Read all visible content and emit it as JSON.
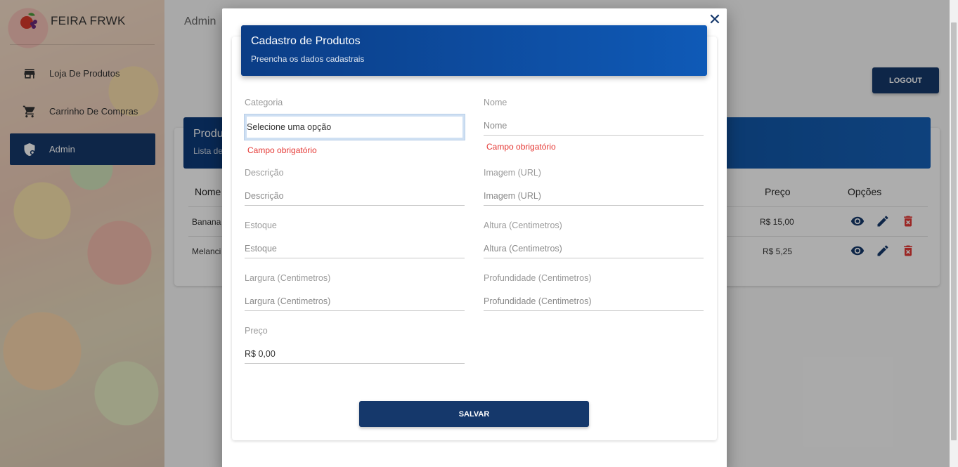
{
  "app": {
    "name": "FEIRA FRWK"
  },
  "sidebar": {
    "items": [
      {
        "label": "Loja De Produtos",
        "icon": "store-icon"
      },
      {
        "label": "Carrinho De Compras",
        "icon": "cart-icon"
      },
      {
        "label": "Admin",
        "icon": "admin-shield-icon",
        "active": true
      }
    ]
  },
  "topbar": {
    "title": "Admin",
    "logout_label": "LOGOUT"
  },
  "products_card": {
    "title": "Produ",
    "subtitle": "Lista de",
    "columns": {
      "name": "Nome",
      "price": "Preço",
      "options": "Opções"
    },
    "rows": [
      {
        "name": "Banana",
        "price": "R$ 15,00"
      },
      {
        "name": "Melanci",
        "price": "R$ 5,25"
      }
    ]
  },
  "modal": {
    "title": "Cadastro de Produtos",
    "subtitle": "Preencha os dados cadastrais",
    "fields": {
      "categoria": {
        "label": "Categoria",
        "value": "Selecione uma opção",
        "error": "Campo obrigatório"
      },
      "nome": {
        "label": "Nome",
        "placeholder": "Nome",
        "error": "Campo obrigatório"
      },
      "descricao": {
        "label": "Descrição",
        "placeholder": "Descrição"
      },
      "imagem": {
        "label": "Imagem (URL)",
        "placeholder": "Imagem (URL)"
      },
      "estoque": {
        "label": "Estoque",
        "placeholder": "Estoque"
      },
      "altura": {
        "label": "Altura (Centimetros)",
        "placeholder": "Altura (Centimetros)"
      },
      "largura": {
        "label": "Largura (Centimetros)",
        "placeholder": "Largura (Centimetros)"
      },
      "profundidade": {
        "label": "Profundidade (Centimetros)",
        "placeholder": "Profundidade (Centimetros)"
      },
      "preco": {
        "label": "Preço",
        "value": "R$ 0,00"
      }
    },
    "save_label": "SALVAR",
    "close_icon": "close-icon"
  },
  "colors": {
    "primary": "#15386b",
    "header_gradient_start": "#0b3d86",
    "header_gradient_end": "#0f5ab7",
    "error": "#e53935"
  }
}
